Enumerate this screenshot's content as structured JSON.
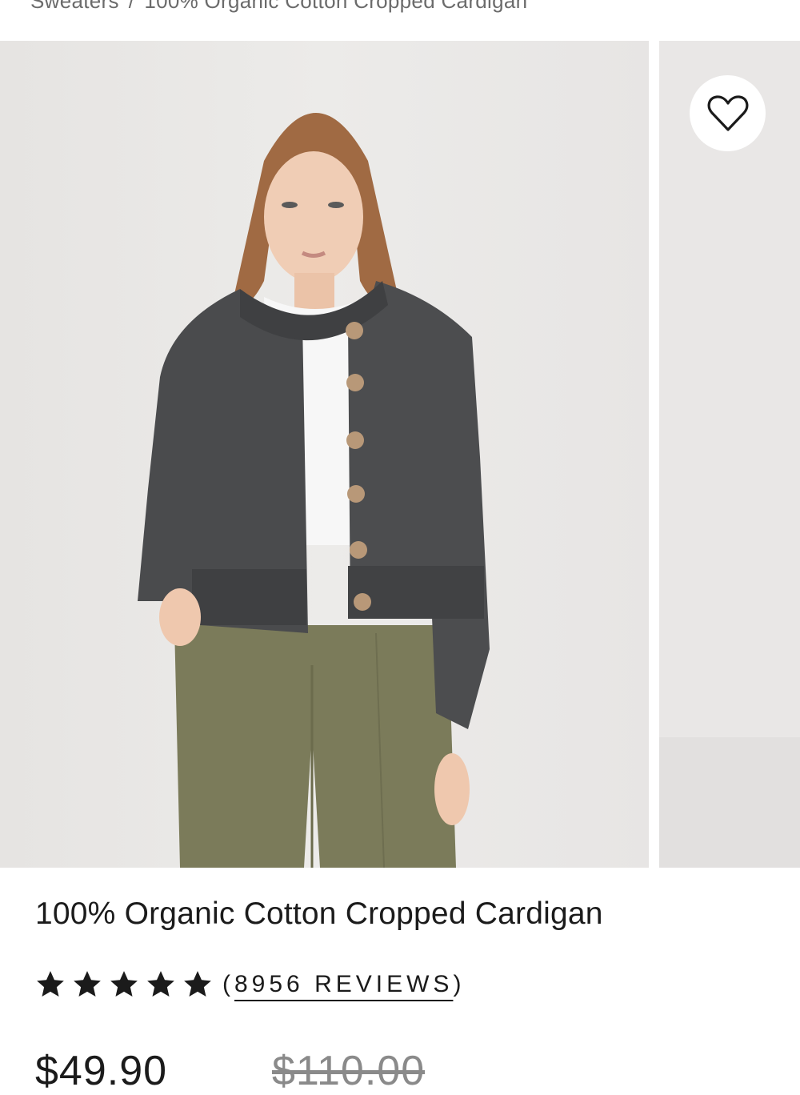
{
  "breadcrumb": {
    "parent": "Sweaters",
    "separator": "/",
    "current": "100% Organic Cotton Cropped Cardigan"
  },
  "gallery": {
    "main_image_alt": "Model wearing charcoal cropped cardigan over white tee with olive trousers",
    "next_image_alt": "Next product image"
  },
  "wishlist": {
    "icon": "heart-outline-icon"
  },
  "product": {
    "title": "100% Organic Cotton Cropped Cardigan",
    "rating": {
      "stars": 5,
      "max": 5,
      "open_paren": "(",
      "reviews_label": "8956 REVIEWS",
      "close_paren": ")"
    },
    "price": {
      "sale": "$49.90",
      "original": "$110.00"
    }
  },
  "colors": {
    "text": "#1b1b1b",
    "muted": "#8a8a8a",
    "photo_bg": "#eae8e7",
    "cardigan": "#4a4b4d",
    "trousers": "#7b7b5a"
  }
}
